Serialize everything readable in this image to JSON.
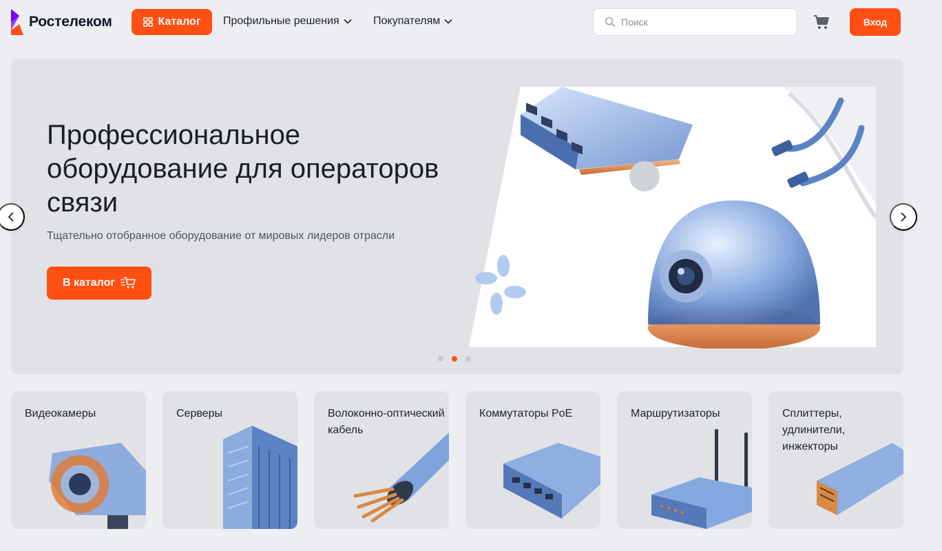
{
  "header": {
    "logo_text": "Ростелеком",
    "catalog_label": "Каталог",
    "nav": [
      {
        "label": "Профильные решения"
      },
      {
        "label": "Покупателям"
      }
    ],
    "search_placeholder": "Поиск",
    "login_label": "Вход"
  },
  "hero": {
    "title": "Профессиональное оборудование для операторов связи",
    "subtitle": "Тщательно отобранное оборудование от мировых лидеров отрасли",
    "button_label": "В каталог",
    "slides_count": 3,
    "active_slide": 2
  },
  "categories": [
    {
      "label": "Видеокамеры",
      "icon": "security-camera"
    },
    {
      "label": "Серверы",
      "icon": "server-rack"
    },
    {
      "label": "Волоконно-оптический кабель",
      "icon": "fiber-cable"
    },
    {
      "label": "Коммутаторы PoE",
      "icon": "network-switch"
    },
    {
      "label": "Маршрутизаторы",
      "icon": "router"
    },
    {
      "label": "Сплиттеры, удлинители, инжекторы",
      "icon": "sfp-module"
    }
  ],
  "colors": {
    "accent": "#ff4f12",
    "brand_purple": "#7700ff",
    "page_bg": "#eceef1",
    "card_bg": "#e0e2e6"
  }
}
